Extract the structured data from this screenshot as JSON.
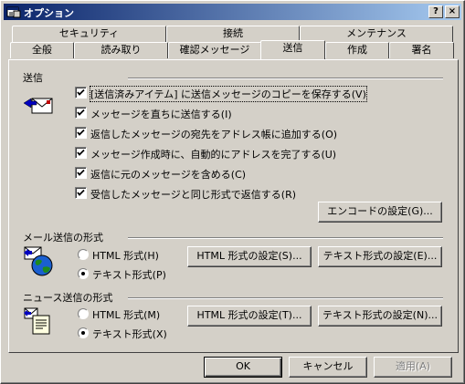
{
  "window": {
    "title": "オプション"
  },
  "titlebar_buttons": {
    "help": "?",
    "close": "×"
  },
  "tabs_row1": [
    "セキュリティ",
    "接続",
    "メンテナンス"
  ],
  "tabs_row2": [
    "全般",
    "読み取り",
    "確認メッセージ",
    "送信",
    "作成",
    "署名"
  ],
  "active_tab": "送信",
  "send_group": {
    "label": "送信",
    "options": [
      {
        "label": "[送信済みアイテム] に送信メッセージのコピーを保存する(V)",
        "checked": true
      },
      {
        "label": "メッセージを直ちに送信する(I)",
        "checked": true
      },
      {
        "label": "返信したメッセージの宛先をアドレス帳に追加する(O)",
        "checked": true
      },
      {
        "label": "メッセージ作成時に、自動的にアドレスを完了する(U)",
        "checked": true
      },
      {
        "label": "返信に元のメッセージを含める(C)",
        "checked": true
      },
      {
        "label": "受信したメッセージと同じ形式で返信する(R)",
        "checked": true
      }
    ],
    "encode_button": "エンコードの設定(G)..."
  },
  "mail_format": {
    "label": "メール送信の形式",
    "html_option": "HTML 形式(H)",
    "text_option": "テキスト形式(P)",
    "selected": "text",
    "html_settings_button": "HTML 形式の設定(S)...",
    "text_settings_button": "テキスト形式の設定(E)..."
  },
  "news_format": {
    "label": "ニュース送信の形式",
    "html_option": "HTML 形式(M)",
    "text_option": "テキスト形式(X)",
    "selected": "text",
    "html_settings_button": "HTML 形式の設定(T)...",
    "text_settings_button": "テキスト形式の設定(N)..."
  },
  "footer": {
    "ok": "OK",
    "cancel": "キャンセル",
    "apply": "適用(A)"
  },
  "colors": {
    "face": "#d4d0c8",
    "title_start": "#0a246a",
    "title_end": "#a6caf0"
  },
  "icons": {
    "title": "options-window-icon",
    "send": "send-envelope-icon",
    "mail": "mail-globe-icon",
    "news": "news-document-icon"
  }
}
